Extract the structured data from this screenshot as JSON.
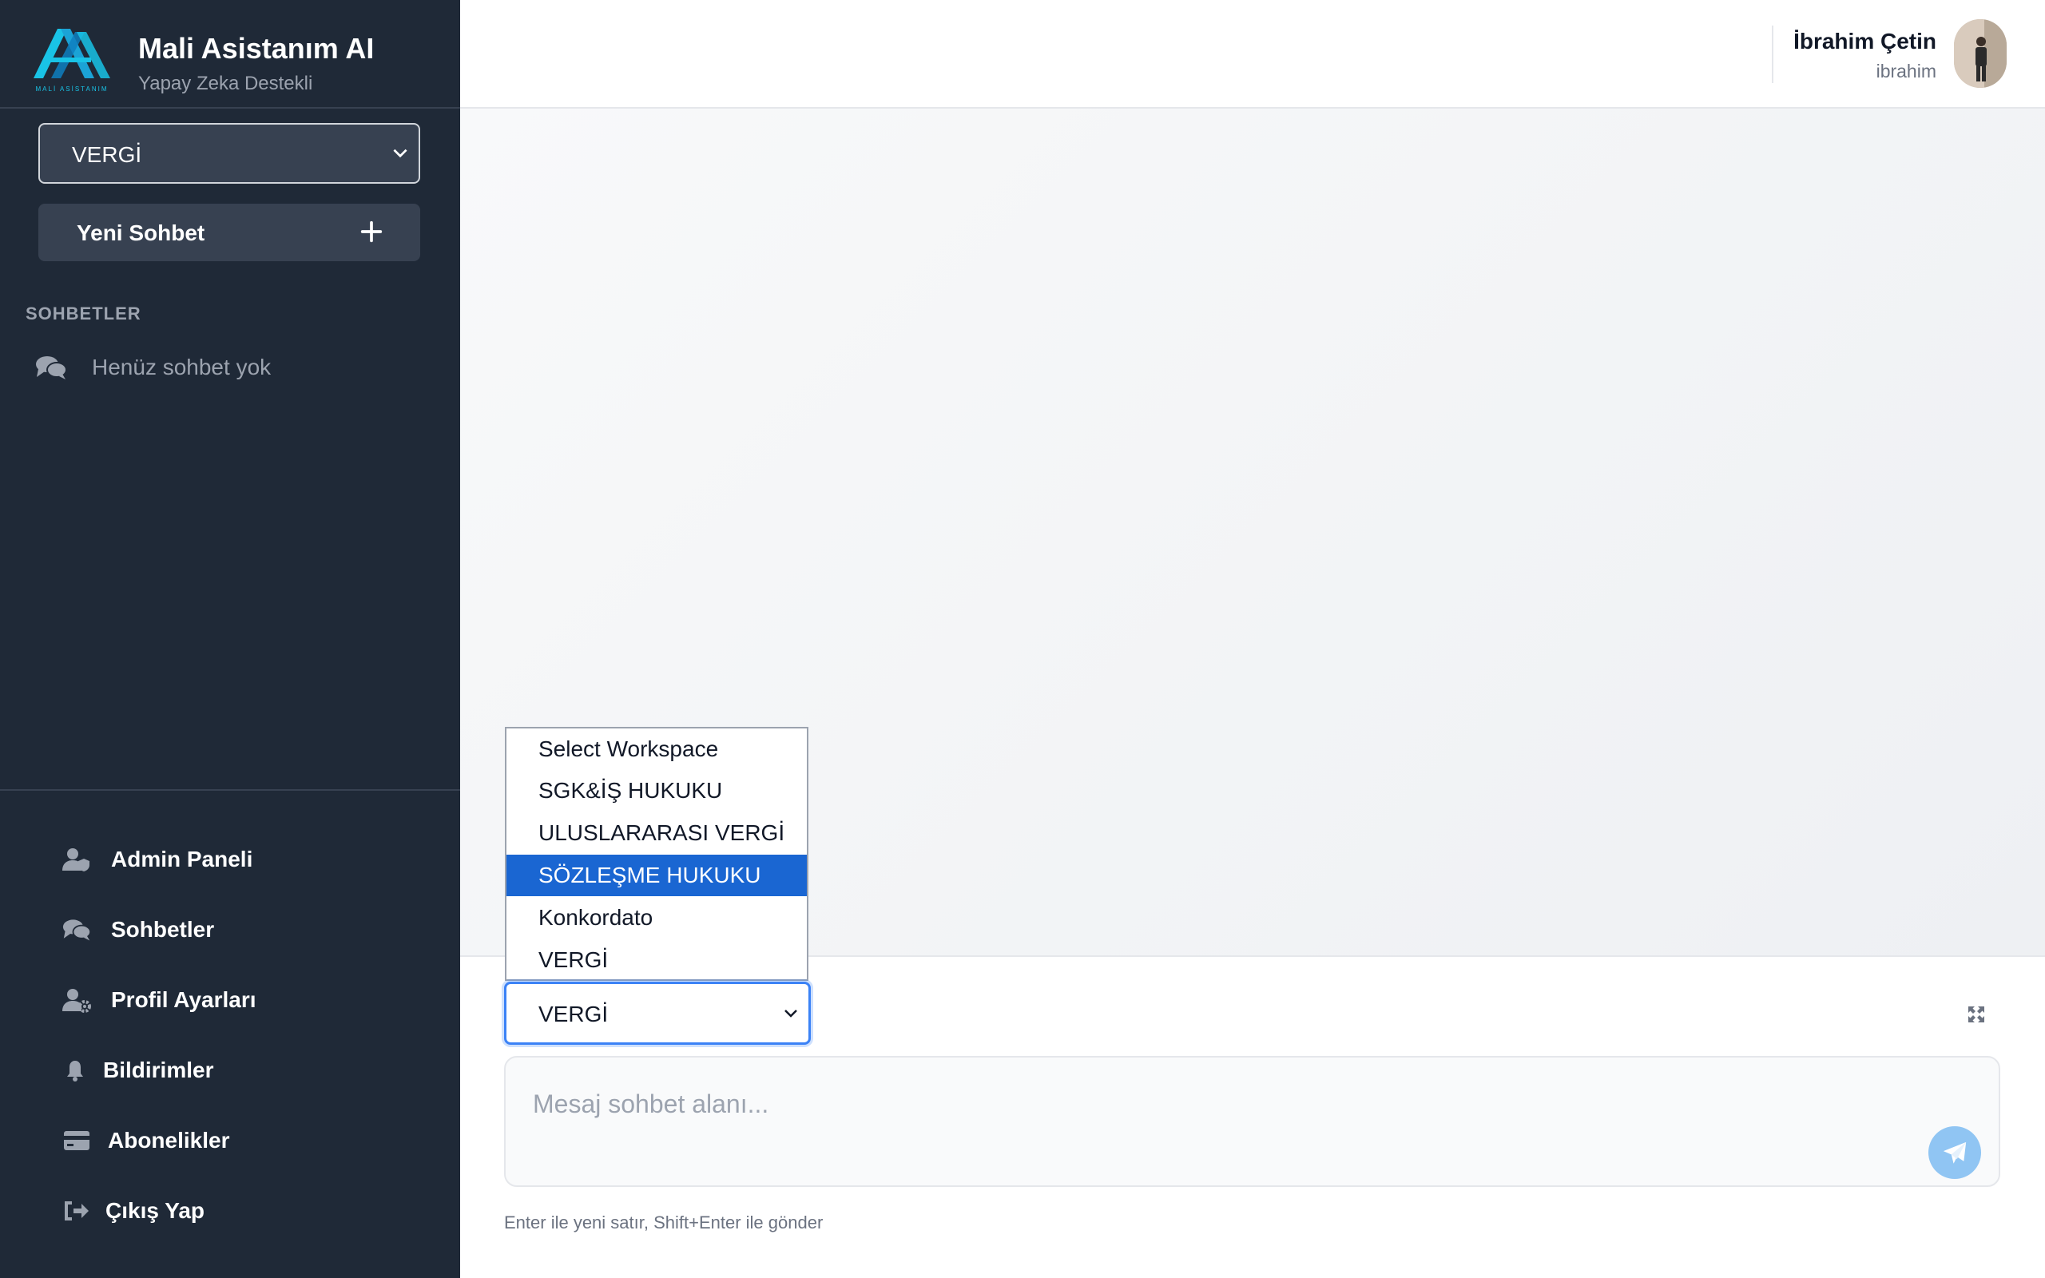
{
  "brand": {
    "title": "Mali Asistanım AI",
    "subtitle": "Yapay Zeka Destekli",
    "logo_caption": "MALİ ASİSTANIM"
  },
  "sidebar": {
    "workspace_select": {
      "value": "VERGİ"
    },
    "new_chat_label": "Yeni Sohbet",
    "section_title": "SOHBETLER",
    "empty_chats": "Henüz sohbet yok",
    "nav": [
      {
        "label": "Admin Paneli",
        "icon": "user-shield-icon"
      },
      {
        "label": "Sohbetler",
        "icon": "comments-icon"
      },
      {
        "label": "Profil Ayarları",
        "icon": "user-gear-icon"
      },
      {
        "label": "Bildirimler",
        "icon": "bell-icon"
      },
      {
        "label": "Abonelikler",
        "icon": "credit-card-icon"
      },
      {
        "label": "Çıkış Yap",
        "icon": "sign-out-icon"
      }
    ]
  },
  "header": {
    "user_name": "İbrahim Çetin",
    "user_handle": "ibrahim"
  },
  "composer": {
    "workspace_select": {
      "value": "VERGİ",
      "options": [
        "Select Workspace",
        "SGK&İŞ HUKUKU",
        "ULUSLARARASI VERGİ",
        "SÖZLEŞME HUKUKU",
        "Konkordato",
        "VERGİ"
      ],
      "highlighted": "SÖZLEŞME HUKUKU"
    },
    "message_placeholder": "Mesaj sohbet alanı...",
    "hint": "Enter ile yeni satır, Shift+Enter ile gönder"
  },
  "colors": {
    "sidebar_bg": "#1f2937",
    "accent": "#3b82f6",
    "highlight": "#1a66d2",
    "send_button": "#90c5f3"
  }
}
